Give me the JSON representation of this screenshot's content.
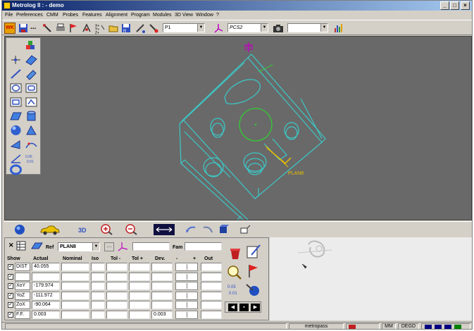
{
  "window": {
    "title": "Metrolog II : - demo"
  },
  "menu": [
    "File",
    "Preferences",
    "CMM",
    "Probes",
    "Features",
    "Alignment",
    "Program",
    "Modules",
    "3D View",
    "Window",
    "?"
  ],
  "toolbar": {
    "wk_label": "WK",
    "dots_label": "...",
    "probe_combo": "P1",
    "frame_combo": "PCS2",
    "empty_combo": ""
  },
  "viewport": {
    "background": "#696969",
    "part_color": "#3cc8c8",
    "highlight_color": "#e8c000",
    "circle_color": "#33cc33",
    "feature_label": "PLAN8"
  },
  "panel": {
    "ref_label": "Ref",
    "ref_value": "PLAN8",
    "fam_label": "Fam",
    "headers": [
      "Show",
      "Actual",
      "Nominal",
      "Iso",
      "Tol -",
      "Tol +",
      "Dev.",
      "-",
      "+",
      "Out"
    ],
    "rows": [
      {
        "name": "DIST",
        "actual": "40.055",
        "dev": ""
      },
      {
        "name": "",
        "actual": "",
        "dev": ""
      },
      {
        "name": "XoY",
        "actual": "-179.974",
        "dev": ""
      },
      {
        "name": "YoZ",
        "actual": "-111.972",
        "dev": ""
      },
      {
        "name": "ZoX",
        "actual": "-90.064",
        "dev": ""
      },
      {
        "name": "F.F.",
        "actual": "0.003",
        "dev": "0.003"
      }
    ]
  },
  "status": {
    "app": "metropass",
    "units": "MM",
    "angle": "DEGD"
  }
}
